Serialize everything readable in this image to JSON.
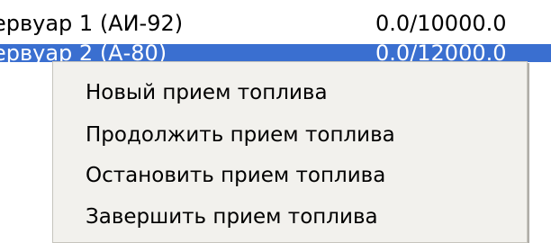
{
  "tank_list": {
    "rows": [
      {
        "name": "ервуар 1 (АИ-92)",
        "value": "0.0/10000.0",
        "selected": false
      },
      {
        "name": "ервуар 2 (А-80)",
        "value": "0.0/12000.0",
        "selected": true
      }
    ]
  },
  "context_menu": {
    "items": [
      {
        "label": "Новый прием топлива"
      },
      {
        "label": "Продолжить прием топлива"
      },
      {
        "label": "Остановить прием топлива"
      },
      {
        "label": "Завершить прием топлива"
      }
    ]
  },
  "colors": {
    "selection": "#3a6fd0",
    "menu_background": "#f2f1ed"
  }
}
